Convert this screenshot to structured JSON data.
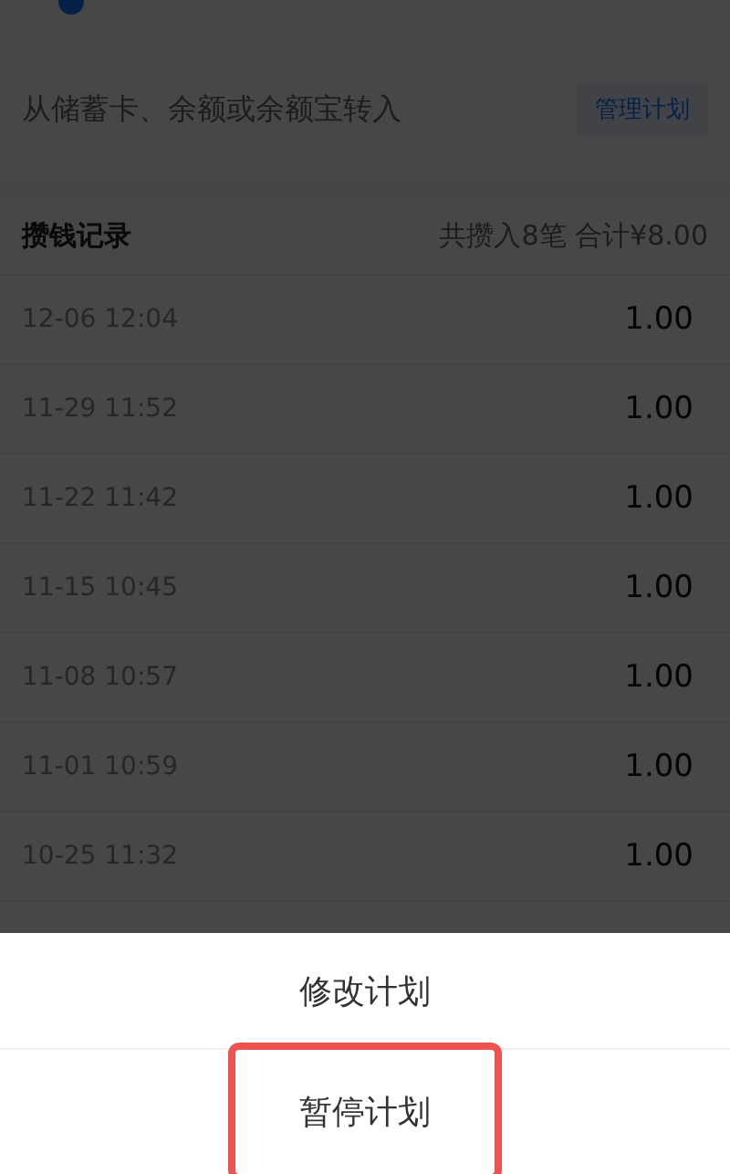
{
  "transfer": {
    "text": "从储蓄卡、余额或余额宝转入",
    "button": "管理计划"
  },
  "records": {
    "title": "攒钱记录",
    "summary": "共攒入8笔 合计¥8.00",
    "rows": [
      {
        "time": "12-06 12:04",
        "amount": "1.00"
      },
      {
        "time": "11-29 11:52",
        "amount": "1.00"
      },
      {
        "time": "11-22 11:42",
        "amount": "1.00"
      },
      {
        "time": "11-15 10:45",
        "amount": "1.00"
      },
      {
        "time": "11-08 10:57",
        "amount": "1.00"
      },
      {
        "time": "11-01 10:59",
        "amount": "1.00"
      },
      {
        "time": "10-25 11:32",
        "amount": "1.00"
      }
    ]
  },
  "sheet": {
    "options": [
      {
        "label": "修改计划",
        "highlighted": false
      },
      {
        "label": "暂停计划",
        "highlighted": true
      }
    ]
  }
}
